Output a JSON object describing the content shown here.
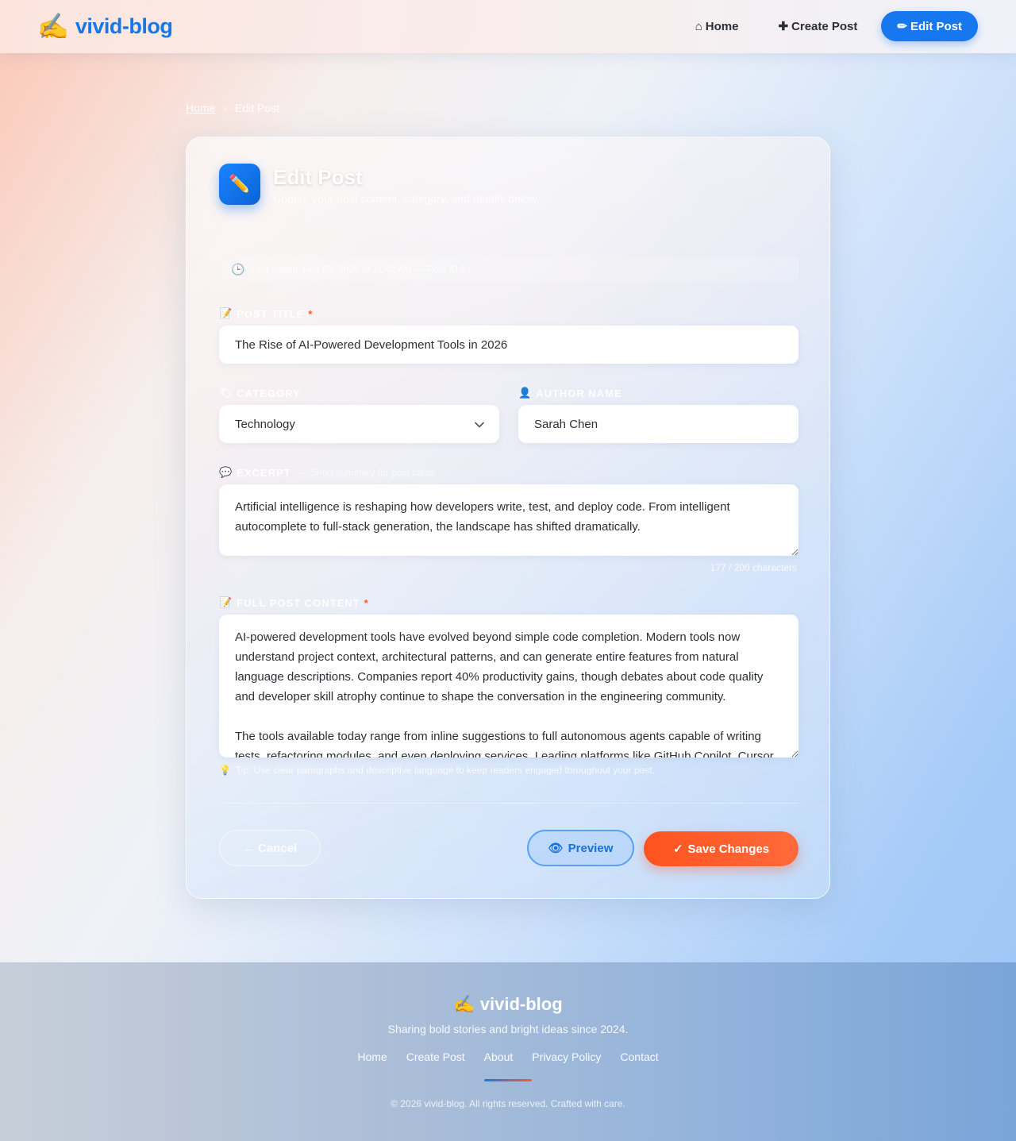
{
  "header": {
    "logo_icon": "✍️",
    "logo_text": "vivid-blog",
    "nav": [
      {
        "icon": "⌂",
        "label": "Home"
      },
      {
        "icon": "✚",
        "label": "Create Post"
      },
      {
        "icon": "✏",
        "label": "Edit Post",
        "active": true
      }
    ]
  },
  "breadcrumb": {
    "home": "Home",
    "separator": "›",
    "current": "Edit Post"
  },
  "card": {
    "icon": "✏️",
    "title": "Edit Post",
    "subtitle": "Update your post content, category, and details below.",
    "meta_icon": "🕒",
    "meta_text": "Last edited: Feb 28, 2026 at 11:42 AM — Post ID #1"
  },
  "form": {
    "title": {
      "icon": "📝",
      "label": "Post Title",
      "required": "*",
      "value": "The Rise of AI-Powered Development Tools in 2026"
    },
    "category": {
      "icon": "🏷",
      "label": "Category",
      "value": "Technology"
    },
    "author": {
      "icon": "👤",
      "label": "Author Name",
      "value": "Sarah Chen"
    },
    "excerpt": {
      "icon": "💬",
      "label": "Excerpt",
      "hint": "— Short summary for post cards",
      "value": "Artificial intelligence is reshaping how developers write, test, and deploy code. From intelligent autocomplete to full-stack generation, the landscape has shifted dramatically.",
      "counter": "177 / 200 characters"
    },
    "content": {
      "icon": "📝",
      "label": "Full Post Content",
      "required": "*",
      "value": "AI-powered development tools have evolved beyond simple code completion. Modern tools now understand project context, architectural patterns, and can generate entire features from natural language descriptions. Companies report 40% productivity gains, though debates about code quality and developer skill atrophy continue to shape the conversation in the engineering community.\n\nThe tools available today range from inline suggestions to full autonomous agents capable of writing tests, refactoring modules, and even deploying services. Leading platforms like GitHub Copilot, Cursor"
    },
    "tip": {
      "icon": "💡",
      "text": "Tip: Use clear paragraphs and descriptive language to keep readers engaged throughout your post."
    }
  },
  "actions": {
    "cancel": "← Cancel",
    "preview_icon": "👁",
    "preview": "Preview",
    "save_icon": "✓",
    "save": "Save Changes"
  },
  "footer": {
    "logo_icon": "✍️",
    "logo_text": "vivid-blog",
    "tagline": "Sharing bold stories and bright ideas since 2024.",
    "links": [
      "Home",
      "Create Post",
      "About",
      "Privacy Policy",
      "Contact"
    ],
    "copyright": "© 2026 vivid-blog. All rights reserved. Crafted with care."
  }
}
